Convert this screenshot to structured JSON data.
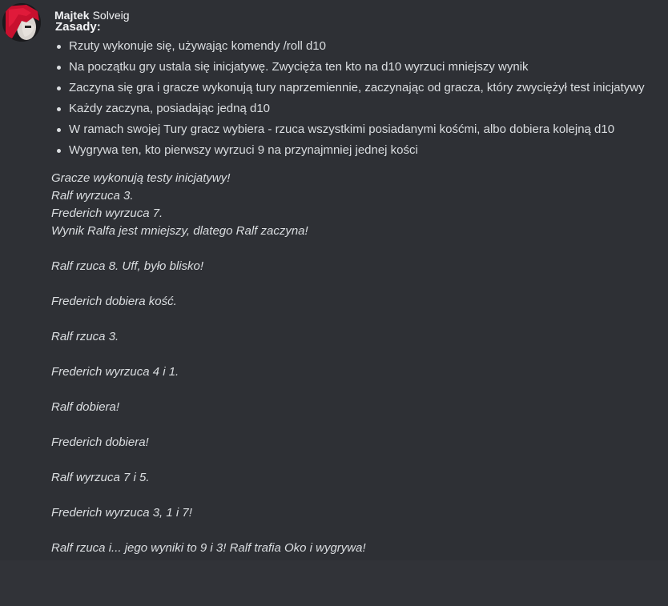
{
  "message": {
    "username": "Majtek",
    "display_name": "Solveig",
    "rules_title": "Zasady:",
    "rules": [
      "Rzuty wykonuje się, używając komendy /roll d10",
      "Na początku gry ustala się inicjatywę. Zwycięża ten kto na d10 wyrzuci mniejszy wynik",
      "Zaczyna się gra i gracze wykonują tury naprzemiennie, zaczynając od gracza, który zwyciężył test inicjatywy",
      "Każdy zaczyna, posiadając jedną d10",
      "W ramach swojej Tury gracz wybiera - rzuca wszystkimi posiadanymi kośćmi, albo dobiera kolejną d10",
      "Wygrywa ten, kto pierwszy wyrzuci 9 na przynajmniej jednej kości"
    ],
    "story": [
      "Gracze wykonują testy inicjatywy!",
      "Ralf wyrzuca 3.",
      "Frederich wyrzuca 7.",
      "Wynik Ralfa jest mniejszy, dlatego Ralf zaczyna!",
      "",
      "Ralf rzuca 8. Uff, było blisko!",
      "",
      "Frederich dobiera kość.",
      "",
      "Ralf rzuca 3.",
      "",
      "Frederich wyrzuca 4 i 1.",
      "",
      "Ralf dobiera!",
      "",
      "Frederich dobiera!",
      "",
      "Ralf wyrzuca 7 i 5.",
      "",
      "Frederich wyrzuca 3, 1 i 7!",
      "",
      "Ralf rzuca i... jego wyniki to 9 i 3! Ralf trafia Oko i wygrywa!"
    ]
  }
}
